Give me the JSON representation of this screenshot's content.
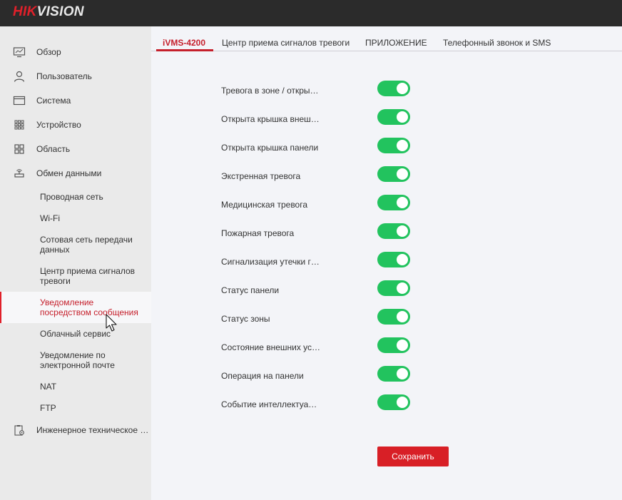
{
  "brand": {
    "logo_part1": "HIK",
    "logo_part2": "VISION"
  },
  "sidebar": {
    "items": [
      {
        "label": "Обзор",
        "icon": "monitor-icon"
      },
      {
        "label": "Пользователь",
        "icon": "user-icon"
      },
      {
        "label": "Система",
        "icon": "system-window-icon"
      },
      {
        "label": "Устройство",
        "icon": "device-grid-icon"
      },
      {
        "label": "Область",
        "icon": "area-grid-icon"
      },
      {
        "label": "Обмен данными",
        "icon": "router-icon"
      }
    ],
    "sub_items": [
      {
        "label": "Проводная сеть"
      },
      {
        "label": "Wi-Fi"
      },
      {
        "label": "Сотовая сеть передачи данных"
      },
      {
        "label": "Центр приема сигналов тревоги"
      },
      {
        "label": "Уведомление посредством сообщения",
        "active": true
      },
      {
        "label": "Облачный сервис"
      },
      {
        "label": "Уведомление по электронной почте"
      },
      {
        "label": "NAT"
      },
      {
        "label": "FTP"
      }
    ],
    "last_item": {
      "label": "Инженерное техническое …",
      "icon": "clipboard-gear-icon"
    }
  },
  "tabs": [
    {
      "label": "iVMS-4200",
      "active": true
    },
    {
      "label": "Центр приема сигналов тревоги"
    },
    {
      "label": "ПРИЛОЖЕНИЕ"
    },
    {
      "label": "Телефонный звонок и SMS"
    }
  ],
  "settings": [
    {
      "label": "Тревога в зоне / откры…",
      "enabled": true
    },
    {
      "label": "Открыта крышка внеш…",
      "enabled": true
    },
    {
      "label": "Открыта крышка панели",
      "enabled": true
    },
    {
      "label": "Экстренная тревога",
      "enabled": true
    },
    {
      "label": "Медицинская тревога",
      "enabled": true
    },
    {
      "label": "Пожарная тревога",
      "enabled": true
    },
    {
      "label": "Сигнализация утечки г…",
      "enabled": true
    },
    {
      "label": "Статус панели",
      "enabled": true
    },
    {
      "label": "Статус зоны",
      "enabled": true
    },
    {
      "label": "Состояние внешних ус…",
      "enabled": true
    },
    {
      "label": "Операция на панели",
      "enabled": true
    },
    {
      "label": "Событие интеллектуа…",
      "enabled": true
    }
  ],
  "save_label": "Сохранить",
  "colors": {
    "accent": "#c51f2b",
    "toggle_on": "#22c35e",
    "button": "#d81f26"
  }
}
